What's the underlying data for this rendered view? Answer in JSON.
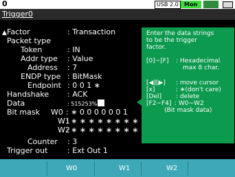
{
  "status_bar": {
    "screen_number": "0",
    "usb_label": "USB 2.0",
    "monitor_label": "Mon"
  },
  "title_tab": "Trigger0",
  "fields": {
    "factor": {
      "label": "Factor",
      "value": ": Transaction"
    },
    "packet_type": {
      "label": "Packet type",
      "value": ""
    },
    "token": {
      "label": "Token",
      "value": ": IN"
    },
    "addr_type": {
      "label": "Addr type",
      "value": ": Value"
    },
    "address": {
      "label": "Address",
      "value": ":     7"
    },
    "endp_type": {
      "label": "ENDP type",
      "value": ": BitMask"
    },
    "endpoint": {
      "label": "Endpoint",
      "value": ": 0 0 1 ∗"
    },
    "handshake": {
      "label": "Handshake",
      "value": ": ACK"
    },
    "data": {
      "label": "Data",
      "value": ": 515253",
      "value_small": "%"
    },
    "bit_mask": {
      "label": "Bit mask",
      "rows": [
        {
          "label": "W0",
          "value": ": ∗ 0 0 0 0 0 0 1"
        },
        {
          "label": "W1",
          "value": ": ∗ ∗ ∗ ∗ ∗ ∗ ∗ ∗"
        },
        {
          "label": "W2",
          "value": ": ∗ ∗ ∗ ∗ ∗ ∗ ∗ ∗"
        }
      ]
    },
    "counter": {
      "label": "Counter",
      "value": ":     3"
    },
    "trigger_out": {
      "label": "Trigger out",
      "value": ": Ext Out 1"
    }
  },
  "help": {
    "intro": [
      "Enter the data strings",
      "to be the trigger",
      "factor."
    ],
    "hex": {
      "key": "[0]~[F]",
      "desc1": ": Hexadecimal",
      "desc2": "max 8 char."
    },
    "move": {
      "key": "[◀][▶]",
      "desc": ": move cursor"
    },
    "x": {
      "key": "[x]",
      "desc": ": ∗(don't care)"
    },
    "del": {
      "key": "[Del]",
      "desc": ": delete"
    },
    "fn": {
      "key": "[F2~F4]",
      "desc1": ": W0~W2",
      "desc2": "(Bit mask data)"
    }
  },
  "function_keys": [
    "",
    "W0",
    "W1",
    "W2",
    ""
  ],
  "colors": {
    "help_bg": "#0c9a4e",
    "fkey_bg": "#3fa8b8",
    "mon_bg": "#3cdc3c"
  }
}
